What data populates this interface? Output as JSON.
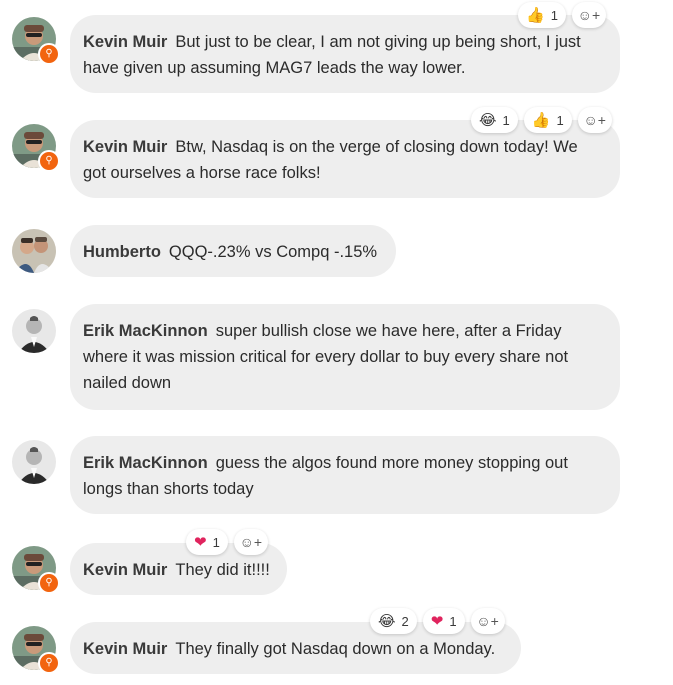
{
  "messages": [
    {
      "author": "Kevin Muir",
      "text": "But just to be clear, I am not giving up being short, I just have given up assuming MAG7 leads the way lower.",
      "reactions": [
        {
          "icon": "thumbs-up",
          "glyph": "👍",
          "count": "1"
        }
      ]
    },
    {
      "author": "Kevin Muir",
      "text": "Btw, Nasdaq is on the verge of closing down today! We got ourselves a horse race folks!",
      "reactions": [
        {
          "icon": "laughing",
          "glyph": "😂",
          "count": "1"
        },
        {
          "icon": "thumbs-up",
          "glyph": "👍",
          "count": "1"
        }
      ]
    },
    {
      "author": "Humberto",
      "text": "QQQ-.23% vs Compq -.15%",
      "reactions": []
    },
    {
      "author": "Erik MacKinnon",
      "text": "super bullish close we have here, after a Friday where it was mission critical for every dollar to buy every share not nailed down",
      "reactions": []
    },
    {
      "author": "Erik MacKinnon",
      "text": "guess the algos found more money stopping out longs than shorts today",
      "reactions": []
    },
    {
      "author": "Kevin Muir",
      "text": "They did it!!!!",
      "reactions": [
        {
          "icon": "heart",
          "glyph": "❤",
          "count": "1"
        }
      ]
    },
    {
      "author": "Kevin Muir",
      "text": "They finally got Nasdaq down on a Monday.",
      "reactions": [
        {
          "icon": "laughing",
          "glyph": "😂",
          "count": "2"
        },
        {
          "icon": "heart",
          "glyph": "❤",
          "count": "1"
        }
      ]
    }
  ],
  "add_reaction_icon": "add-reaction-icon",
  "colors": {
    "bubble": "#eeeeee",
    "badge": "#f2640f",
    "heart": "#e0245e"
  }
}
